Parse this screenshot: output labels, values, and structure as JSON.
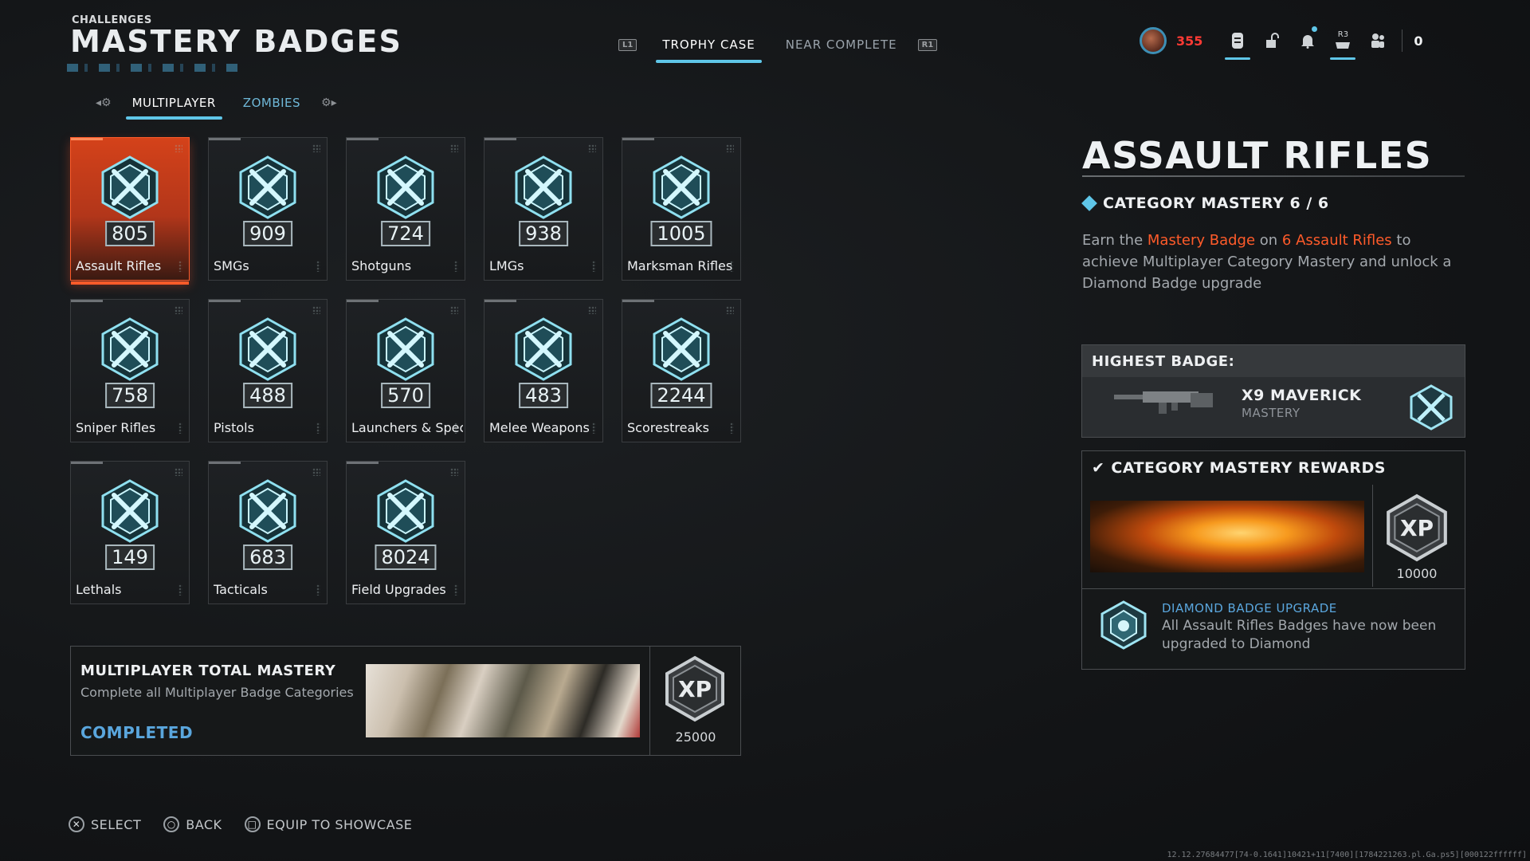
{
  "header": {
    "kicker": "CHALLENGES",
    "title": "MASTERY BADGES"
  },
  "top_nav": {
    "left_button": "L1",
    "right_button": "R1",
    "tabs": [
      {
        "label": "TROPHY CASE",
        "active": true
      },
      {
        "label": "NEAR COMPLETE",
        "active": false
      }
    ]
  },
  "hud": {
    "currency": "355",
    "r3_label": "R3",
    "party_count": "0",
    "icons": [
      "avatar-icon",
      "store-icon",
      "unlock-icon",
      "bell-icon",
      "controller-icon",
      "party-icon"
    ]
  },
  "sub_tabs": [
    {
      "label": "MULTIPLAYER",
      "active": true
    },
    {
      "label": "ZOMBIES",
      "active": false
    }
  ],
  "badges": [
    {
      "label": "Assault Rifles",
      "count": "805",
      "selected": true
    },
    {
      "label": "SMGs",
      "count": "909",
      "selected": false
    },
    {
      "label": "Shotguns",
      "count": "724",
      "selected": false
    },
    {
      "label": "LMGs",
      "count": "938",
      "selected": false
    },
    {
      "label": "Marksman Rifles",
      "count": "1005",
      "selected": false
    },
    {
      "label": "Sniper Rifles",
      "count": "758",
      "selected": false
    },
    {
      "label": "Pistols",
      "count": "488",
      "selected": false
    },
    {
      "label": "Launchers & Spec",
      "count": "570",
      "selected": false
    },
    {
      "label": "Melee Weapons",
      "count": "483",
      "selected": false
    },
    {
      "label": "Scorestreaks",
      "count": "2244",
      "selected": false
    },
    {
      "label": "Lethals",
      "count": "149",
      "selected": false
    },
    {
      "label": "Tacticals",
      "count": "683",
      "selected": false
    },
    {
      "label": "Field Upgrades",
      "count": "8024",
      "selected": false
    }
  ],
  "total_mastery": {
    "title": "MULTIPLAYER TOTAL MASTERY",
    "description": "Complete all Multiplayer Badge Categories",
    "status": "COMPLETED",
    "xp_label": "XP",
    "xp_amount": "25000"
  },
  "detail": {
    "title": "ASSAULT RIFLES",
    "mastery_line": "CATEGORY MASTERY 6 / 6",
    "desc_prefix": "Earn the ",
    "desc_hl1": "Mastery Badge",
    "desc_mid": " on ",
    "desc_hl2": "6 Assault Rifles",
    "desc_suffix": " to achieve Multiplayer Category Mastery and unlock a Diamond Badge upgrade",
    "highest_badge": {
      "label": "HIGHEST BADGE:",
      "weapon": "X9 MAVERICK",
      "sub": "MASTERY"
    },
    "rewards": {
      "title": "CATEGORY MASTERY REWARDS",
      "xp_label": "XP",
      "xp_amount": "10000",
      "upgrade_title": "DIAMOND BADGE UPGRADE",
      "upgrade_desc": "All Assault Rifles Badges have now been upgraded to Diamond"
    }
  },
  "footer": [
    {
      "glyph": "✕",
      "label": "SELECT"
    },
    {
      "glyph": "○",
      "label": "BACK"
    },
    {
      "glyph": "□",
      "label": "EQUIP TO SHOWCASE"
    }
  ],
  "debug_text": "12.12.27684477[74-0.1641]10421+11[7400][1784221263.pl.Ga.ps5][000122ffffff]",
  "colors": {
    "accent": "#5fc6e8",
    "selected": "#d4421a",
    "highlight": "#ff5b2a",
    "completed": "#5aa6dd",
    "currency": "#ff3a34"
  }
}
